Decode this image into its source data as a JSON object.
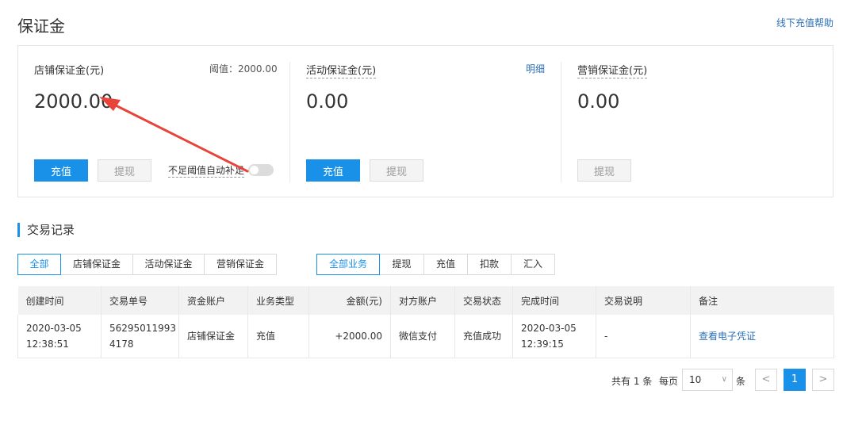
{
  "header": {
    "title": "保证金",
    "help_link": "线下充值帮助"
  },
  "cards": {
    "store": {
      "label": "店铺保证金(元)",
      "threshold": "阈值：2000.00",
      "amount": "2000.00",
      "recharge": "充值",
      "withdraw": "提现",
      "auto_topup_label": "不足阈值自动补足",
      "auto_topup_on": false
    },
    "activity": {
      "label": "活动保证金(元)",
      "detail_link": "明细",
      "amount": "0.00",
      "recharge": "充值",
      "withdraw": "提现"
    },
    "marketing": {
      "label": "营销保证金(元)",
      "amount": "0.00",
      "withdraw": "提现"
    }
  },
  "records": {
    "title": "交易记录",
    "account_tabs": [
      "全部",
      "店铺保证金",
      "活动保证金",
      "营销保证金"
    ],
    "account_tab_active": "全部",
    "type_tabs": [
      "全部业务",
      "提现",
      "充值",
      "扣款",
      "汇入"
    ],
    "type_tab_active": "全部业务",
    "columns": [
      "创建时间",
      "交易单号",
      "资金账户",
      "业务类型",
      "金额(元)",
      "对方账户",
      "交易状态",
      "完成时间",
      "交易说明",
      "备注"
    ],
    "rows": [
      {
        "created": "2020-03-05 12:38:51",
        "order_no": "562950119934178",
        "account": "店铺保证金",
        "type": "充值",
        "amount": "+2000.00",
        "counterparty": "微信支付",
        "status": "充值成功",
        "completed": "2020-03-05 12:39:15",
        "description": "-",
        "remark": "查看电子凭证"
      }
    ]
  },
  "pager": {
    "total": "共有 1 条",
    "per_page_label": "每页",
    "per_page": "10",
    "unit": "条",
    "current_page": "1"
  },
  "colors": {
    "primary": "#1a91e8",
    "link": "#2b6fb6",
    "arrow": "#e8443a"
  }
}
